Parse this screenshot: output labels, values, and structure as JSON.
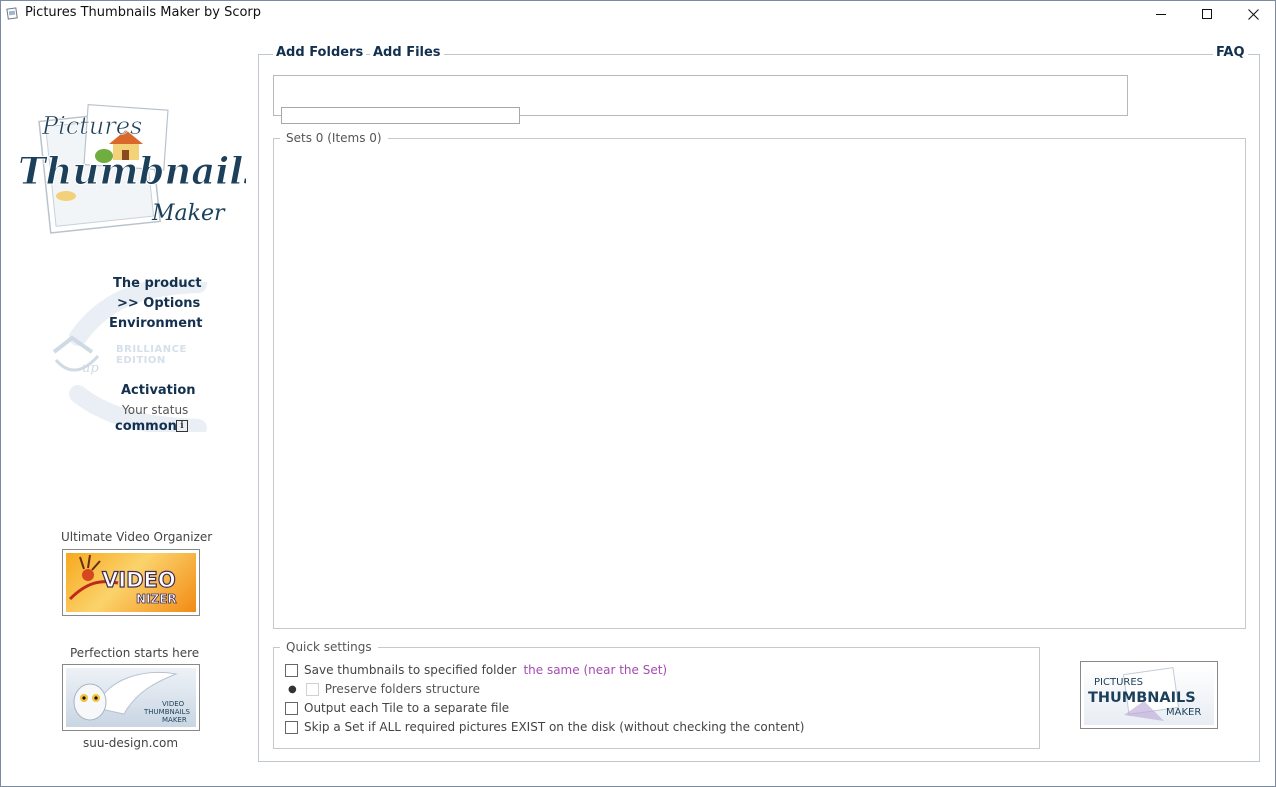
{
  "window": {
    "title": "Pictures Thumbnails Maker by Scorp",
    "minimize_icon": "minimize-icon",
    "maximize_icon": "maximize-icon",
    "close_icon": "close-icon"
  },
  "logo": {
    "line1": "Pictures",
    "line2": "Thumbnails",
    "line3": "Maker"
  },
  "nav": {
    "product": "The product",
    "options": ">> Options",
    "environment": "Environment",
    "activation": "Activation",
    "your_status": "Your status",
    "status_value": "common",
    "info_icon": "i"
  },
  "edition": {
    "line1": "BRILLIANCE",
    "line2": "EDITION",
    "mark": "up"
  },
  "promos": {
    "video_caption": "Ultimate Video Organizer",
    "video_banner_line1": "VIDEO",
    "video_banner_line2": "NIZER",
    "vtm_caption": "Perfection starts here",
    "vtm_banner_line1": "VIDEO",
    "vtm_banner_line2": "THUMBNAILS",
    "vtm_banner_line3": "MAKER",
    "site": "suu-design.com"
  },
  "toolbar": {
    "add_folders": "Add Folders",
    "add_files": "Add Files",
    "faq": "FAQ"
  },
  "sets": {
    "legend": "Sets 0 (Items 0)"
  },
  "quick_settings": {
    "legend": "Quick settings",
    "save_thumbnails": "Save thumbnails to specified folder",
    "save_target": "the same (near the Set)",
    "preserve": "Preserve folders structure",
    "output_tile": "Output each Tile to a separate file",
    "skip_set": "Skip a Set if ALL required pictures EXIST on the disk (without checking the content)"
  },
  "ptm_badge": {
    "line1": "PICTURES",
    "line2": "THUMBNAILS",
    "line3": "MAKER"
  },
  "colors": {
    "nav_text": "#13304f",
    "accent_purple": "#a64ab3",
    "frame_border": "#bfc7cf"
  }
}
